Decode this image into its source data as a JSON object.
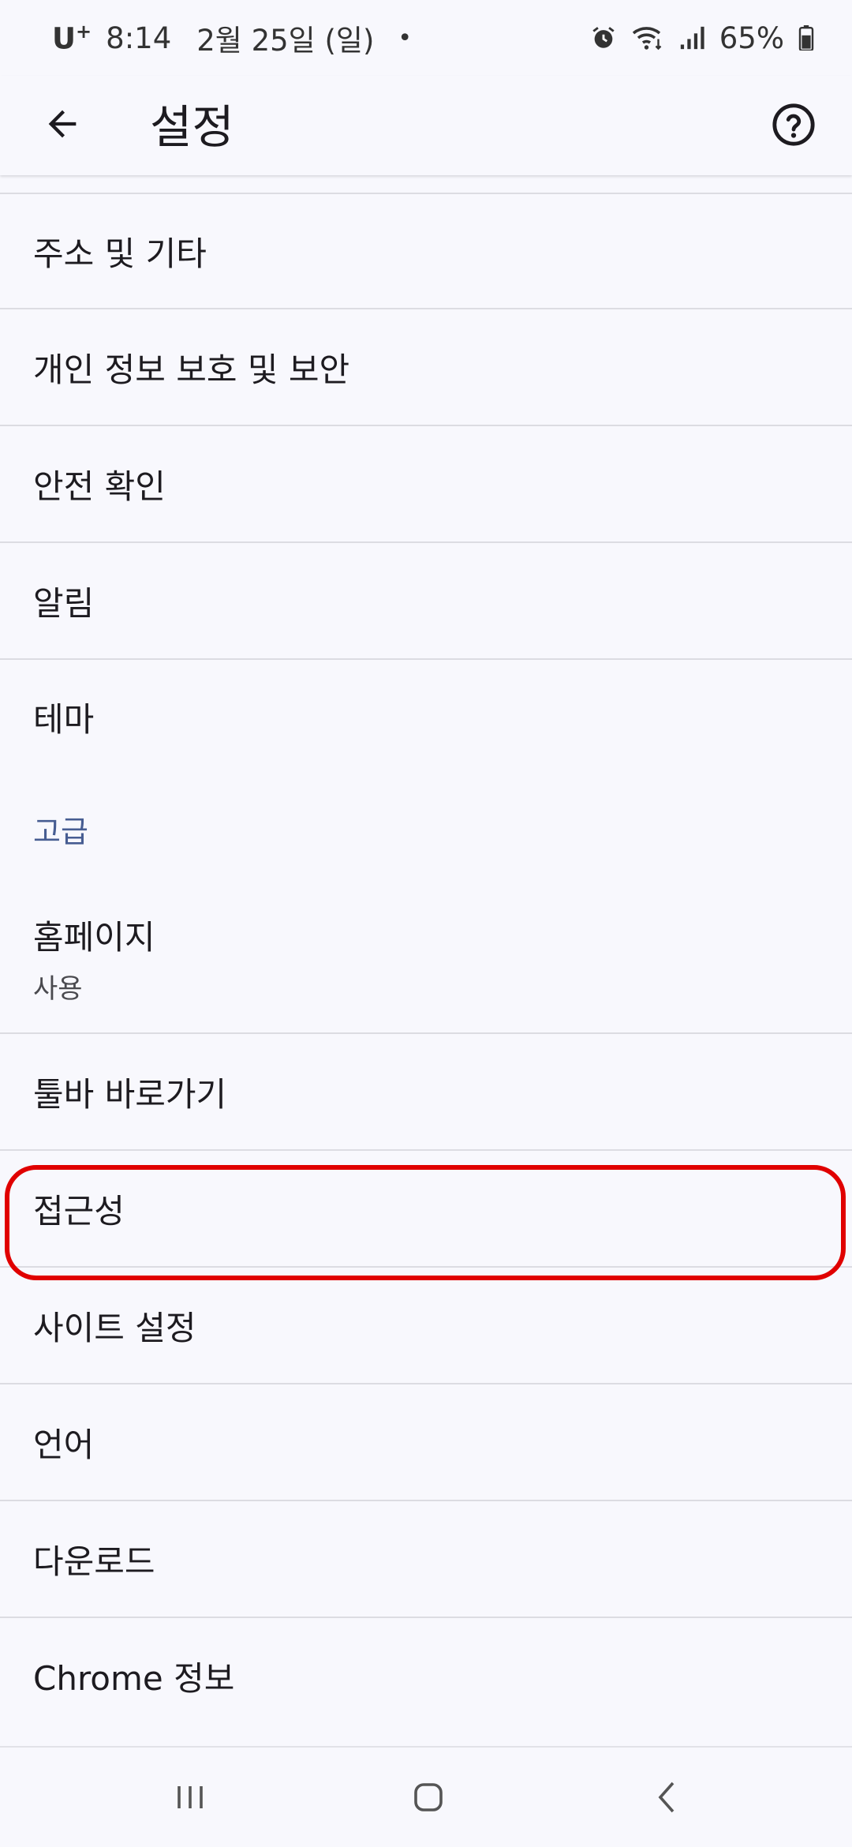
{
  "status_bar": {
    "carrier": "U",
    "carrier_sup": "+",
    "time": "8:14",
    "date": "2월 25일 (일)",
    "dot": "•",
    "battery": "65%"
  },
  "app_bar": {
    "title": "설정",
    "back_icon": "arrow-left-icon",
    "help_icon": "help-circle-icon"
  },
  "list": {
    "address": "주소 및 기타",
    "privacy": "개인 정보 보호 및 보안",
    "safety_check": "안전 확인",
    "notifications": "알림",
    "theme": "테마",
    "advanced_header": "고급",
    "homepage": "홈페이지",
    "homepage_summary": "사용",
    "toolbar_shortcut": "툴바 바로가기",
    "accessibility": "접근성",
    "site_settings": "사이트 설정",
    "languages": "언어",
    "downloads": "다운로드",
    "about_chrome": "Chrome 정보"
  },
  "colors": {
    "background": "#f8f8fd",
    "section_header": "#475d92",
    "highlight": "#e00000",
    "divider": "#dcdce2"
  }
}
